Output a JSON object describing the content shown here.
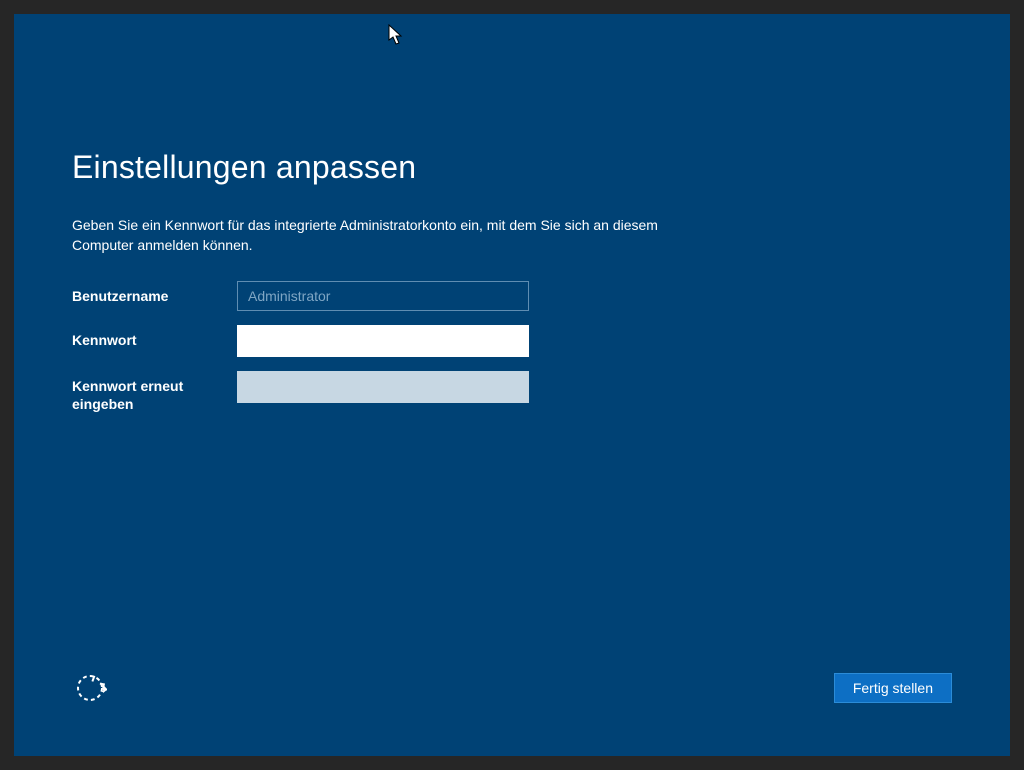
{
  "page": {
    "title": "Einstellungen anpassen",
    "description": "Geben Sie ein Kennwort für das integrierte Administratorkonto ein, mit dem Sie sich an diesem Computer anmelden können."
  },
  "form": {
    "username_label": "Benutzername",
    "username_value": "Administrator",
    "password_label": "Kennwort",
    "password_value": "",
    "password_confirm_label": "Kennwort erneut eingeben",
    "password_confirm_value": ""
  },
  "footer": {
    "finish_label": "Fertig stellen"
  }
}
